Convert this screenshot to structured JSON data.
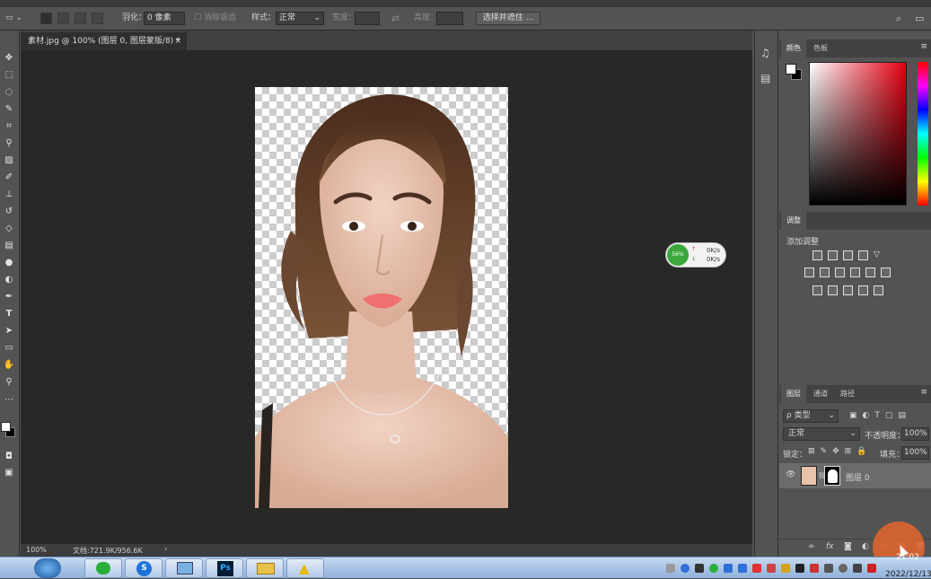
{
  "options_bar": {
    "feather_label": "羽化：",
    "feather_value": "0 像素",
    "antialias_label": "消除锯齿",
    "style_label": "样式：",
    "style_value": "正常",
    "width_label": "宽度：",
    "height_label": "高度：",
    "select_mask_button": "选择并遮住 ..."
  },
  "document": {
    "tab_title": "素材.jpg @ 100% (图层 0, 图层蒙版/8) *",
    "zoom": "100%",
    "doc_size": "文档:721.9K/956.6K"
  },
  "net_widget": {
    "percent": "56%",
    "upload": "0K/s",
    "download": "0K/s"
  },
  "color_panel": {
    "tab_color": "颜色",
    "tab_swatches": "色板"
  },
  "adjust_panel": {
    "tab": "调整",
    "add_adjustment": "添加调整"
  },
  "layers_panel": {
    "tab_layers": "图层",
    "tab_channels": "通道",
    "tab_paths": "路径",
    "filter_kind": "ρ 类型",
    "blend_mode": "正常",
    "opacity_label": "不透明度：",
    "opacity_value": "100%",
    "lock_label": "锁定：",
    "fill_label": "填充：",
    "fill_value": "100%",
    "layer_name": "图层 0",
    "footer_fx": "fx"
  },
  "taskbar": {
    "time": "21:02",
    "date": "2022/12/13"
  },
  "colors": {
    "canvas_bg": "#282828",
    "panel_bg": "#535353",
    "accent_orange": "#e0642e"
  }
}
